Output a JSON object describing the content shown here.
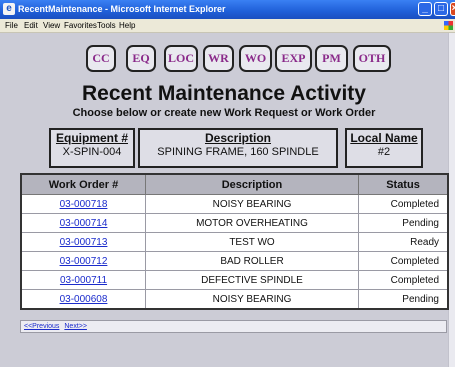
{
  "window": {
    "title": "RecentMaintenance - Microsoft Internet Explorer"
  },
  "menu": [
    "File",
    "Edit",
    "View",
    "Favorites",
    "Tools",
    "Help"
  ],
  "nav_buttons": [
    "CC",
    "EQ",
    "LOC",
    "WR",
    "WO",
    "EXP",
    "PM",
    "OTH"
  ],
  "heading": {
    "title": "Recent Maintenance Activity",
    "subtitle": "Choose below or create new Work Request or Work Order"
  },
  "equipment": {
    "label": "Equipment #",
    "value": "X-SPIN-004"
  },
  "description": {
    "label": "Description",
    "value": "SPINING FRAME, 160 SPINDLE"
  },
  "local_name": {
    "label": "Local Name",
    "value": "#2"
  },
  "table": {
    "columns": [
      "Work Order #",
      "Description",
      "Status"
    ],
    "rows": [
      [
        "03-000718",
        "NOISY BEARING",
        "Completed"
      ],
      [
        "03-000714",
        "MOTOR OVERHEATING",
        "Pending"
      ],
      [
        "03-000713",
        "TEST WO",
        "Ready"
      ],
      [
        "03-000712",
        "BAD ROLLER",
        "Completed"
      ],
      [
        "03-000711",
        "DEFECTIVE SPINDLE",
        "Completed"
      ],
      [
        "03-000608",
        "NOISY BEARING",
        "Pending"
      ]
    ]
  },
  "pager": {
    "previous": "<<Previous",
    "next": "Next>>"
  }
}
